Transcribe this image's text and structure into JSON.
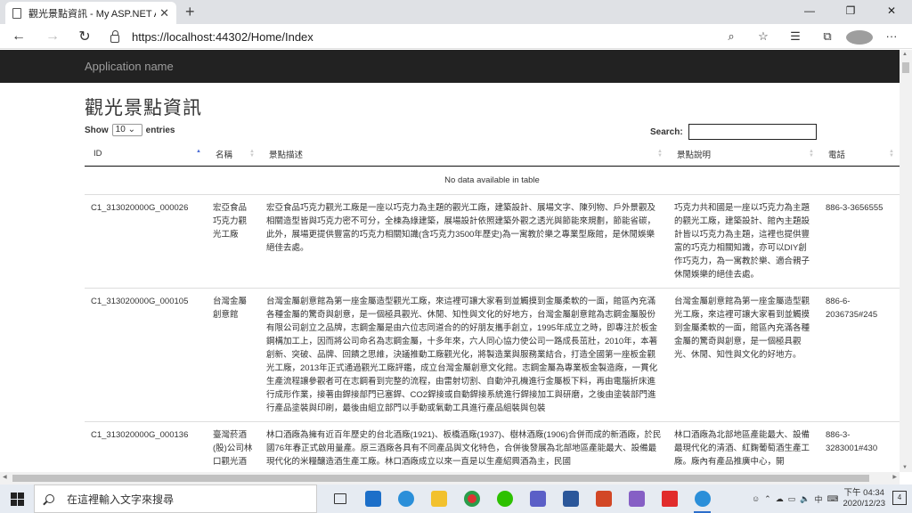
{
  "browser": {
    "tab_title": "觀光景點資訊 - My ASP.NET App",
    "tab_close": "✕",
    "new_tab": "+",
    "url": "https://localhost:44302/Home/Index",
    "win_min": "—",
    "win_max": "❐",
    "win_close": "✕",
    "back": "←",
    "forward": "→",
    "reload": "↻"
  },
  "site": {
    "brand": "Application name",
    "page_title": "觀光景點資訊",
    "show_label": "Show",
    "page_length": "10",
    "entries_label": "entries",
    "search_label": "Search:"
  },
  "table": {
    "columns": [
      "ID",
      "名稱",
      "景點描述",
      "景點說明",
      "電話"
    ],
    "sort_column": "ID",
    "empty_message": "No data available in table",
    "rows": [
      {
        "id": "C1_313020000G_000026",
        "name": "宏亞食品巧克力觀光工廠",
        "desc": "宏亞食品巧克力觀光工廠是一座以巧克力為主題的觀光工廠，建築設計、展場文字、陳列物、戶外景觀及相關造型皆與巧克力密不可分，全棟為綠建築，展場設計依照建築外觀之透光與節能來規劃，節能省碳，此外，展場更提供豐富的巧克力相關知識(含巧克力3500年歷史)為一寓教於樂之專業型廠館，是休閒娛樂絕佳去處。",
        "info": "巧克力共和國是一座以巧克力為主題的觀光工廠，建築設計、館內主題設計皆以巧克力為主題，這裡也提供豐富的巧克力相關知識，亦可以DIY創作巧克力，為一寓教於樂、適合親子休閒娛樂的絕佳去處。",
        "phone": "886-3-3656555"
      },
      {
        "id": "C1_313020000G_000105",
        "name": "台灣金屬創意館",
        "desc": "台灣金屬創意館為第一座金屬造型觀光工廠，來這裡可讓大家看到並觸摸到金屬柔軟的一面，館區內充滿各種金屬的驚奇與創意，是一個極具觀光、休閒、知性與文化的好地方，台灣金屬創意館為志鋼金屬股份有限公司創立之品牌，志鋼金屬是由六位志同道合的的好朋友攜手創立，1995年成立之時，即專注於板金鋼構加工上，因而將公司命名為志鋼金屬，十多年來，六人同心協力使公司一路成長茁壯，2010年，本著創新、突破、品牌、回饋之思維，決議推動工廠觀光化，將製造業與服務業結合，打造全國第一座板金觀光工廠，2013年正式通過觀光工廠評鑑，成立台灣金屬創意文化館。志鋼金屬為專業板金製造廠，一貫化生產流程讓參觀者可在志鋼看到完整的流程，由雷射切割、自動沖孔機進行金屬板下料，再由電腦折床進行成形作業，接著由銲接部門已塞銲、CO2銲接或自動銲接系統進行銲接加工與研磨，之後由塗裝部門進行產品塗裝與印刷，最後由組立部門以手動或氣動工具進行產品組裝與包裝",
        "info": "台灣金屬創意館為第一座金屬造型觀光工廠，來這裡可讓大家看到並觸摸到金屬柔軟的一面，館區內充滿各種金屬的驚奇與創意，是一個極具觀光、休閒、知性與文化的好地方。",
        "phone": "886-6-2036735#245"
      },
      {
        "id": "C1_313020000G_000136",
        "name": "臺灣菸酒(股)公司林口觀光酒",
        "desc": "林口酒廠為擁有近百年歷史的台北酒廠(1921)、板橋酒廠(1937)、樹林酒廠(1906)合併而成的新酒廠，於民國76年春正式啟用量產。原三酒廠各具有不同產品與文化特色，合併後發展為北部地區產能最大、設備最現代化的米糧釀造酒生產工廠。林口酒廠成立以來一直是以生產紹興酒為主，民國",
        "info": "林口酒廠為北部地區產能最大、設備最現代化的清酒、紅麴葡萄酒生產工廠。廠內有產品推廣中心，開",
        "phone": "886-3-3283001#430"
      }
    ]
  },
  "taskbar": {
    "search_placeholder": "在這裡輸入文字來搜尋",
    "time": "下午 04:34",
    "date": "2020/12/23",
    "notif_count": "4",
    "ime": "中"
  }
}
